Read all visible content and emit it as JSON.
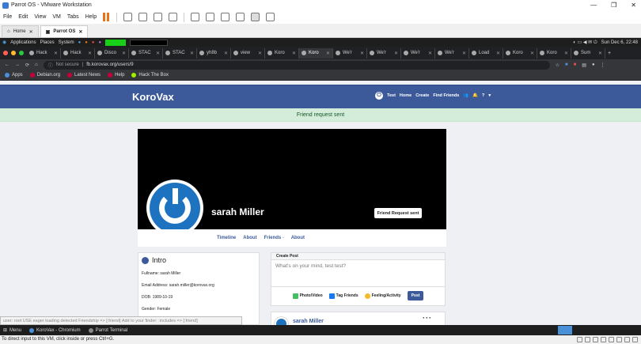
{
  "window": {
    "title": "Parrot OS - VMware Workstation",
    "controls": [
      "—",
      "❐",
      "✕"
    ]
  },
  "vmmenu": [
    "File",
    "Edit",
    "View",
    "VM",
    "Tabs",
    "Help"
  ],
  "vmtabs": [
    {
      "label": "Home",
      "close": "✕"
    },
    {
      "label": "Parrot OS",
      "close": "✕"
    }
  ],
  "panel": {
    "items": [
      "Applications",
      "Places",
      "System"
    ],
    "datetime": "Sun Dec 6, 22:48"
  },
  "chrome_tabs": [
    "Hack",
    "Hack",
    "Disco",
    "STAC",
    "STAC",
    "yh8b",
    "view",
    "Koro",
    "Koro",
    "We'r",
    "We'r",
    "We'r",
    "We'r",
    "Load",
    "Koro",
    "Koro",
    "Sum"
  ],
  "address": {
    "secure_label": "Not secure",
    "url": "fb.korovax.org/users/9"
  },
  "bookmarks": [
    "Apps",
    "Debian.org",
    "Latest News",
    "Help",
    "Hack The Box"
  ],
  "site": {
    "brand": "KoroVax",
    "nav": [
      "Test",
      "Home",
      "Create",
      "Find Friends"
    ],
    "alert": "Friend request sent",
    "profile_name": "sarah Miller",
    "friend_button": "Friend Request sent",
    "profile_tabs": [
      "Timeline",
      "About",
      "Friends",
      "About"
    ],
    "intro": {
      "title": "Intro",
      "fullname": "Fullname: sarah Miller",
      "email": "Email Address: sarah.miller@korovax.org",
      "dob": "DOB: 1989-10-19",
      "gender": "Gender: Female"
    },
    "create_post": {
      "header": "Create Post",
      "placeholder": "What's on your mind, test test?",
      "photo": "Photo/Video",
      "tag": "Tag Friends",
      "feeling": "Feeling/Activity",
      "post": "Post"
    },
    "feed_post": {
      "author": "sarah Miller",
      "menu": "···"
    },
    "toast": "user: root USE eager loading detected Friendship => [:friend] Add to your finder: :includes => [:friend]"
  },
  "taskbar": {
    "menu": "Menu",
    "chromium": "KoroVax - Chromium",
    "terminal": "Parrot Terminal"
  },
  "status": "To direct input to this VM, click inside or press Ctrl+G."
}
